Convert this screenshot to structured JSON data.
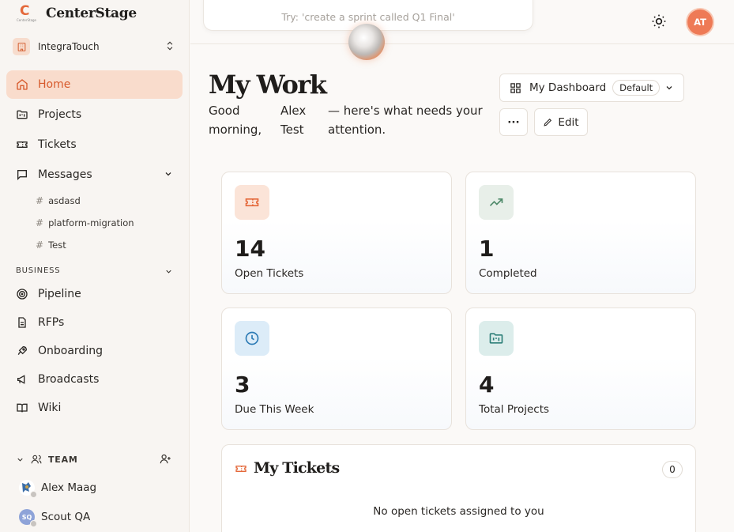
{
  "brand": {
    "name": "CenterStage",
    "logo_letter": "C",
    "logo_text": "CenterStage"
  },
  "org": {
    "name": "IntegraTouch"
  },
  "nav": {
    "home": "Home",
    "projects": "Projects",
    "tickets": "Tickets",
    "messages": "Messages",
    "channels": [
      "asdasd",
      "platform-migration",
      "Test"
    ],
    "business_label": "BUSINESS",
    "pipeline": "Pipeline",
    "rfps": "RFPs",
    "onboarding": "Onboarding",
    "broadcasts": "Broadcasts",
    "wiki": "Wiki"
  },
  "team": {
    "label": "TEAM",
    "members": [
      {
        "name": "Alex Maag",
        "initials": ""
      },
      {
        "name": "Scout QA",
        "initials": "SQ"
      }
    ]
  },
  "topbar": {
    "command_placeholder": "Try: 'create a sprint called Q1 Final'",
    "user_initials": "AT"
  },
  "main": {
    "title": "My Work",
    "greeting": [
      "Good morning,",
      "Alex Test",
      "— here's what needs your attention."
    ],
    "dashboard_label": "My Dashboard",
    "dashboard_badge": "Default",
    "more_label": "···",
    "edit_label": "Edit"
  },
  "stats": [
    {
      "value": "14",
      "label": "Open Tickets",
      "icon": "ticket-icon",
      "color": "#fbe4d8"
    },
    {
      "value": "1",
      "label": "Completed",
      "icon": "trending-up-icon",
      "color": "#e8efe9"
    },
    {
      "value": "3",
      "label": "Due This Week",
      "icon": "clock-icon",
      "color": "#dcecf8"
    },
    {
      "value": "4",
      "label": "Total Projects",
      "icon": "folder-kanban-icon",
      "color": "#dcedeb"
    }
  ],
  "my_tickets": {
    "title": "My Tickets",
    "count": "0",
    "empty": "No open tickets assigned to you"
  },
  "colors": {
    "accent": "#e4683a",
    "active_bg": "#f9dccc"
  }
}
